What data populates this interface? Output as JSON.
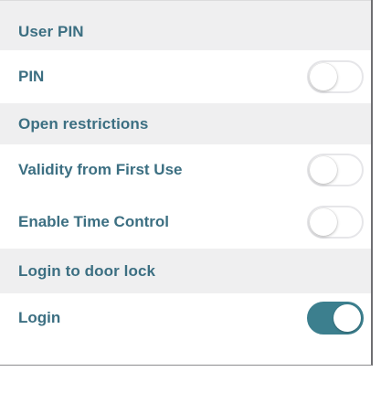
{
  "sections": {
    "user_pin": {
      "header": "User PIN",
      "rows": [
        {
          "label": "PIN",
          "toggle_on": false
        }
      ]
    },
    "open_restrictions": {
      "header": "Open restrictions",
      "rows": [
        {
          "label": "Validity from First Use",
          "toggle_on": false
        },
        {
          "label": "Enable Time Control",
          "toggle_on": false
        }
      ]
    },
    "login_door_lock": {
      "header": "Login to door lock",
      "rows": [
        {
          "label": "Login",
          "toggle_on": true
        }
      ]
    }
  },
  "colors": {
    "accent": "#3c7f8e",
    "text": "#3c6f82",
    "background": "#efeff0",
    "row_background": "#ffffff"
  }
}
